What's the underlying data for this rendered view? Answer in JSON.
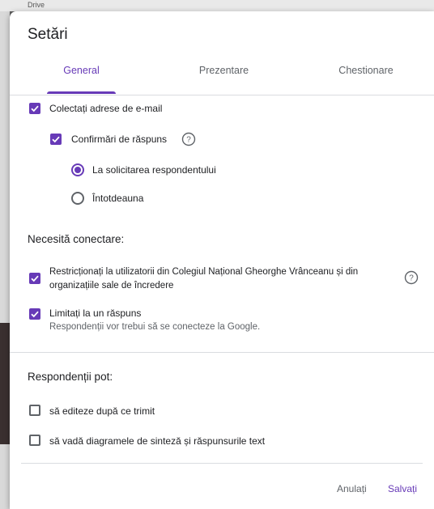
{
  "background": {
    "top_text": "Drive"
  },
  "dialog": {
    "title": "Setări",
    "tabs": [
      {
        "label": "General",
        "active": true
      },
      {
        "label": "Prezentare",
        "active": false
      },
      {
        "label": "Chestionare",
        "active": false
      }
    ],
    "collect_emails": {
      "label": "Colectați adrese de e-mail",
      "checked": true
    },
    "response_receipts": {
      "label": "Confirmări de răspuns",
      "checked": true
    },
    "receipt_options": [
      {
        "label": "La solicitarea respondentului",
        "selected": true
      },
      {
        "label": "Întotdeauna",
        "selected": false
      }
    ],
    "requires_signin": {
      "heading": "Necesită conectare:",
      "restrict": {
        "line1": "Restricționați la utilizatorii din Colegiul Național Gheorghe Vrânceanu și din",
        "line2": "organizațiile sale de încredere",
        "checked": true
      },
      "limit": {
        "label": "Limitați la un răspuns",
        "sublabel": "Respondenții vor trebui să se conecteze la Google.",
        "checked": true
      }
    },
    "respondents_can": {
      "heading": "Respondenții pot:",
      "options": [
        {
          "label": "să editeze după ce trimit",
          "checked": false
        },
        {
          "label": "să vadă diagramele de sinteză și răspunsurile text",
          "checked": false
        }
      ]
    },
    "actions": {
      "cancel": "Anulați",
      "save": "Salvați"
    },
    "colors": {
      "accent": "#673ab7",
      "text": "#202124",
      "secondary": "#5f6368"
    }
  }
}
